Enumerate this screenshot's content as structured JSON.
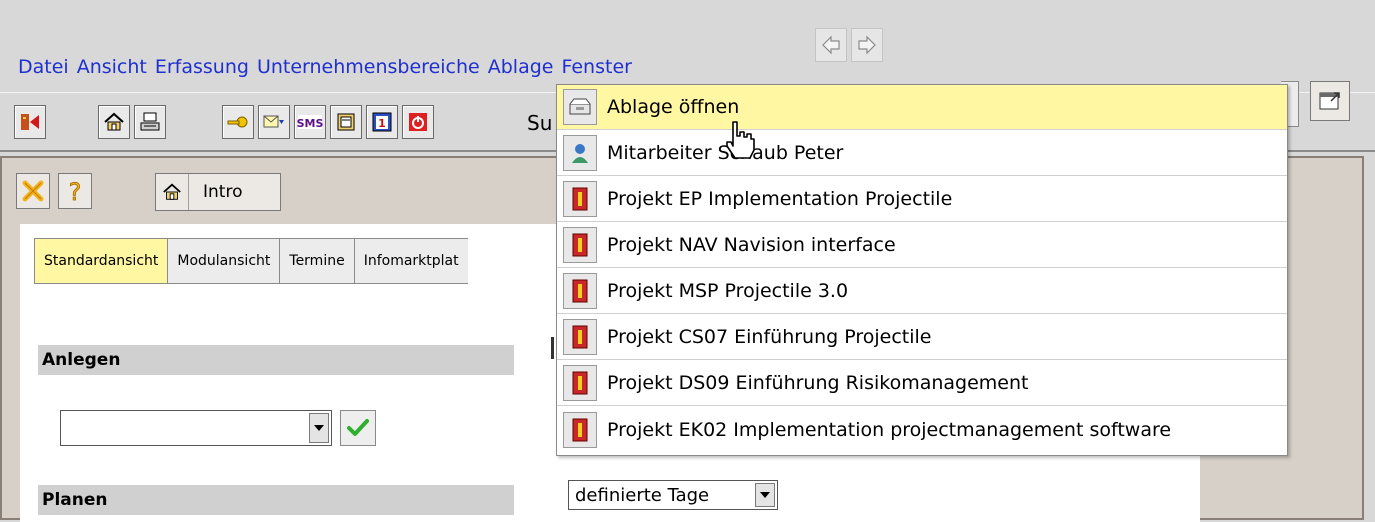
{
  "menubar": {
    "items": [
      "Datei",
      "Ansicht",
      "Erfassung",
      "Unternehmensbereiche",
      "Ablage",
      "Fenster"
    ]
  },
  "toolbar": {
    "search_label": "Su"
  },
  "panel": {
    "intro_tab_label": "Intro",
    "tabs": [
      "Standardansicht",
      "Modulansicht",
      "Termine",
      "Infomarktplat"
    ]
  },
  "sections": {
    "anlegen": "Anlegen",
    "planen": "Planen"
  },
  "days_select": {
    "value": "definierte Tage"
  },
  "ablage_menu": {
    "items": [
      {
        "label": "Ablage öffnen",
        "icon": "drawer-icon"
      },
      {
        "label": "Mitarbeiter Schaub Peter",
        "icon": "person-icon"
      },
      {
        "label": "Projekt EP Implementation Projectile",
        "icon": "project-icon"
      },
      {
        "label": "Projekt NAV Navision interface",
        "icon": "project-icon"
      },
      {
        "label": "Projekt MSP Projectile 3.0",
        "icon": "project-icon"
      },
      {
        "label": "Projekt CS07 Einführung Projectile",
        "icon": "project-icon"
      },
      {
        "label": "Projekt DS09 Einführung Risikomanagement",
        "icon": "project-icon"
      },
      {
        "label": "Projekt EK02 Implementation projectmanagement software",
        "icon": "project-icon"
      }
    ]
  },
  "colors": {
    "menu_text": "#1f2fd0",
    "highlight": "#fff7a2",
    "panel_bg": "#d6d0c9"
  }
}
